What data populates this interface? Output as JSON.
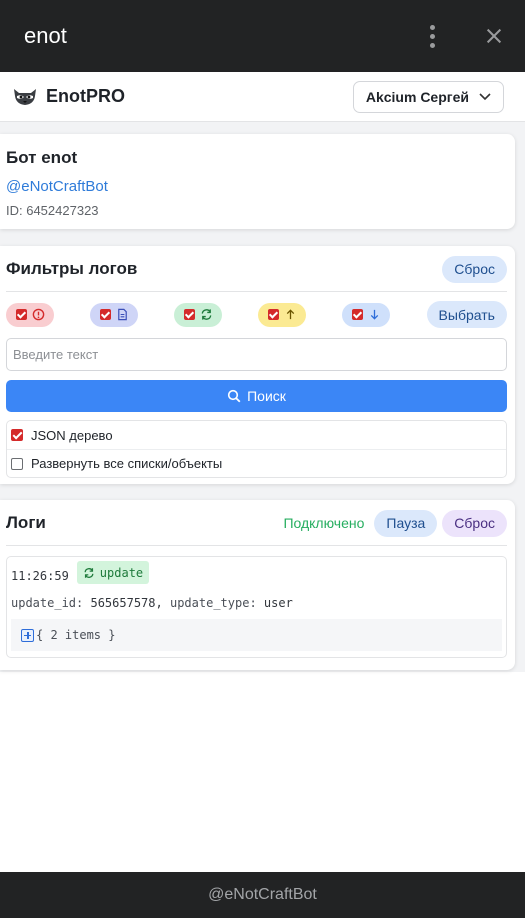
{
  "window": {
    "title": "enot"
  },
  "app": {
    "brand": "EnotPRO",
    "account_select": "Akcium Сергей"
  },
  "bot": {
    "name": "Бот enot",
    "handle": "@eNotCraftBot",
    "id": "ID: 6452427323"
  },
  "filters": {
    "title": "Фильтры логов",
    "reset": "Сброс",
    "select": "Выбрать",
    "input_placeholder": "Введите текст",
    "search": "Поиск",
    "chips": [
      {
        "icon": "error-icon",
        "color": "#d42a2a"
      },
      {
        "icon": "document-icon",
        "color": "#3b4fb8"
      },
      {
        "icon": "refresh-icon",
        "color": "#1e7a3b"
      },
      {
        "icon": "arrow-up-icon",
        "color": "#8a6d00"
      },
      {
        "icon": "arrow-down-icon",
        "color": "#2e6dd9"
      }
    ],
    "options": [
      {
        "label": "JSON дерево",
        "checked": true
      },
      {
        "label": "Развернуть все списки/объекты",
        "checked": false
      }
    ]
  },
  "logs": {
    "title": "Логи",
    "status": "Подключено",
    "pause": "Пауза",
    "reset": "Сброс",
    "entries": [
      {
        "time": "11:26:59",
        "type": "update",
        "update_id_key": "update_id:",
        "update_id": "565657578,",
        "update_type_key": "update_type:",
        "update_type": "user",
        "tree": "{ 2 items }"
      }
    ]
  },
  "footer": {
    "text": "@eNotCraftBot"
  },
  "colors": {
    "accent": "#3b86f6",
    "connected": "#27ae60",
    "dark_bar": "#222324"
  }
}
